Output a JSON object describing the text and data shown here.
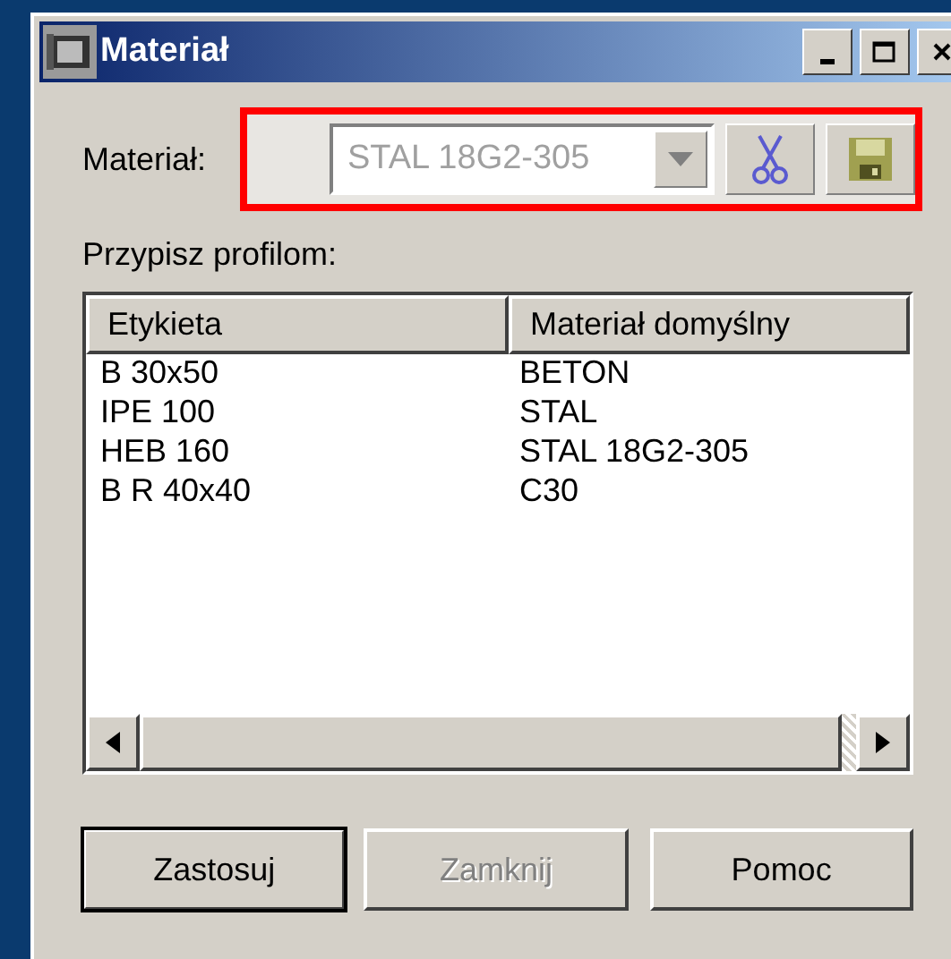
{
  "window": {
    "title": "Materiał"
  },
  "material": {
    "label": "Materiał:",
    "value": "STAL 18G2-305",
    "disabled": true,
    "highlighted": true
  },
  "assign_label": "Przypisz profilom:",
  "table": {
    "columns": [
      "Etykieta",
      "Materiał domyślny"
    ],
    "rows": [
      {
        "cells": [
          "B 30x50",
          "BETON"
        ]
      },
      {
        "cells": [
          "IPE 100",
          "STAL"
        ]
      },
      {
        "cells": [
          "HEB 160",
          "STAL 18G2-305"
        ]
      },
      {
        "cells": [
          "B R 40x40",
          "C30"
        ]
      }
    ]
  },
  "buttons": [
    {
      "label": "Zastosuj",
      "disabled": false,
      "default": true
    },
    {
      "label": "Zamknij",
      "disabled": true,
      "default": false
    },
    {
      "label": "Pomoc",
      "disabled": false,
      "default": false
    }
  ]
}
